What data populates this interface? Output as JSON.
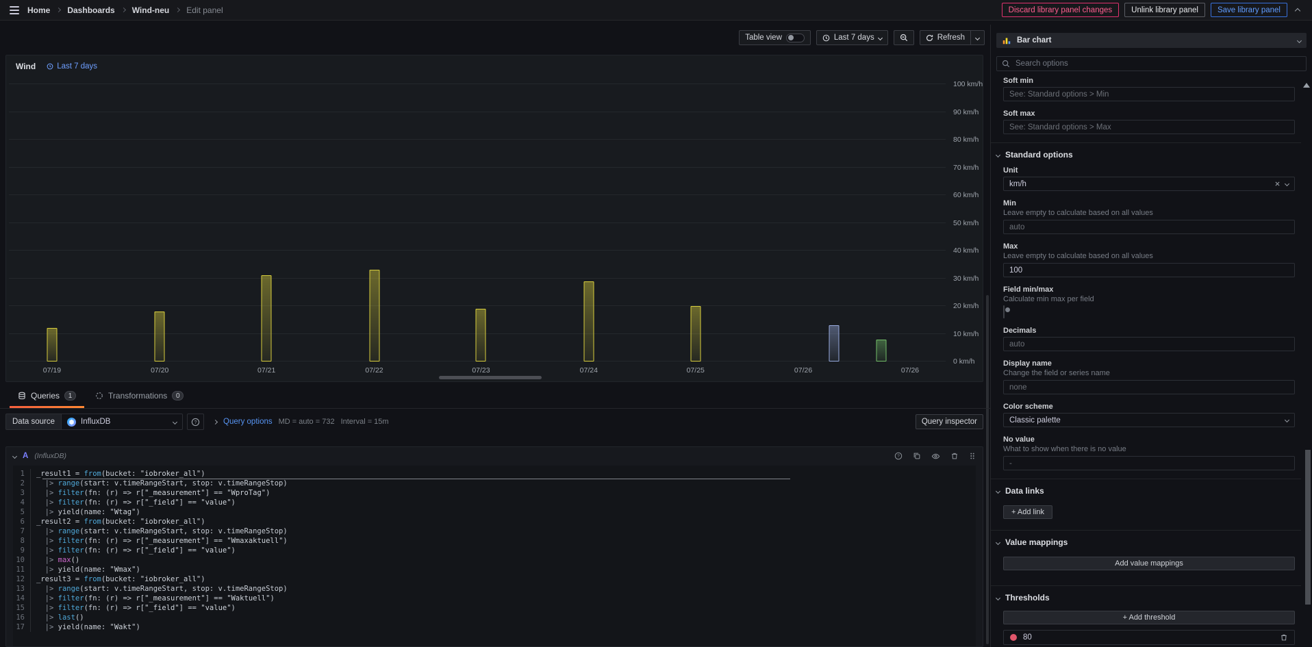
{
  "topnav": {
    "breadcrumb": [
      "Home",
      "Dashboards",
      "Wind-neu",
      "Edit panel"
    ],
    "discard_label": "Discard library panel changes",
    "unlink_label": "Unlink library panel",
    "save_label": "Save library panel"
  },
  "toolbar": {
    "table_view_label": "Table view",
    "time_range_label": "Last 7 days",
    "refresh_label": "Refresh"
  },
  "panel": {
    "title": "Wind",
    "time_tag": "Last 7 days"
  },
  "chart_data": {
    "type": "bar",
    "title": "Wind",
    "unit": "km/h",
    "ylim": [
      0,
      100
    ],
    "tick_step": 10,
    "grid": true,
    "legend": "none",
    "x_ticks": [
      {
        "f": 0.046,
        "label": "07/19"
      },
      {
        "f": 0.161,
        "label": "07/20"
      },
      {
        "f": 0.275,
        "label": "07/21"
      },
      {
        "f": 0.39,
        "label": "07/22"
      },
      {
        "f": 0.504,
        "label": "07/23"
      },
      {
        "f": 0.619,
        "label": "07/24"
      },
      {
        "f": 0.733,
        "label": "07/25"
      },
      {
        "f": 0.848,
        "label": "07/26"
      },
      {
        "f": 0.962,
        "label": "07/26"
      }
    ],
    "series": [
      {
        "name": "Wtag",
        "color": "#d8ce3d",
        "points": [
          {
            "f": 0.046,
            "value": 12
          },
          {
            "f": 0.161,
            "value": 18
          },
          {
            "f": 0.275,
            "value": 31
          },
          {
            "f": 0.39,
            "value": 33
          },
          {
            "f": 0.504,
            "value": 19
          },
          {
            "f": 0.619,
            "value": 29
          },
          {
            "f": 0.733,
            "value": 20
          }
        ]
      },
      {
        "name": "Wmax",
        "color": "#98abdf",
        "points": [
          {
            "f": 0.881,
            "value": 13
          }
        ]
      },
      {
        "name": "Wakt",
        "color": "#73bf69",
        "points": [
          {
            "f": 0.931,
            "value": 8
          }
        ]
      }
    ]
  },
  "queries_pane": {
    "tabs": {
      "queries_label": "Queries",
      "queries_badge": "1",
      "transformations_label": "Transformations",
      "transformations_badge": "0"
    },
    "datasource_label": "Data source",
    "datasource_value": "InfluxDB",
    "query_options_label": "Query options",
    "query_options_meta": "MD = auto = 732",
    "interval_meta": "Interval = 15m",
    "inspector_label": "Query inspector",
    "query": {
      "ref": "A",
      "ds_hint": "(InfluxDB)",
      "code_lines": [
        "_result1 = from(bucket: \"iobroker_all\")",
        "  |> range(start: v.timeRangeStart, stop: v.timeRangeStop)",
        "  |> filter(fn: (r) => r[\"_measurement\"] == \"WproTag\")",
        "  |> filter(fn: (r) => r[\"_field\"] == \"value\")",
        "  |> yield(name: \"Wtag\")",
        "_result2 = from(bucket: \"iobroker_all\")",
        "  |> range(start: v.timeRangeStart, stop: v.timeRangeStop)",
        "  |> filter(fn: (r) => r[\"_measurement\"] == \"Wmaxaktuell\")",
        "  |> filter(fn: (r) => r[\"_field\"] == \"value\")",
        "  |> max()",
        "  |> yield(name: \"Wmax\")",
        "_result3 = from(bucket: \"iobroker_all\")",
        "  |> range(start: v.timeRangeStart, stop: v.timeRangeStop)",
        "  |> filter(fn: (r) => r[\"_measurement\"] == \"Waktuell\")",
        "  |> filter(fn: (r) => r[\"_field\"] == \"value\")",
        "  |> last()",
        "  |> yield(name: \"Wakt\")"
      ]
    }
  },
  "sidebar": {
    "viz_name": "Bar chart",
    "search_placeholder": "Search options",
    "soft_min": {
      "label": "Soft min",
      "placeholder": "See: Standard options > Min"
    },
    "soft_max": {
      "label": "Soft max",
      "placeholder": "See: Standard options > Max"
    },
    "standard": {
      "header": "Standard options",
      "unit": {
        "label": "Unit",
        "value": "km/h"
      },
      "min": {
        "label": "Min",
        "desc": "Leave empty to calculate based on all values",
        "placeholder": "auto"
      },
      "max": {
        "label": "Max",
        "desc": "Leave empty to calculate based on all values",
        "value": "100"
      },
      "field_minmax": {
        "label": "Field min/max",
        "desc": "Calculate min max per field"
      },
      "decimals": {
        "label": "Decimals",
        "placeholder": "auto"
      },
      "display_name": {
        "label": "Display name",
        "desc": "Change the field or series name",
        "placeholder": "none"
      },
      "color_scheme": {
        "label": "Color scheme",
        "value": "Classic palette"
      },
      "no_value": {
        "label": "No value",
        "desc": "What to show when there is no value",
        "placeholder": "-"
      }
    },
    "data_links": {
      "header": "Data links",
      "add_label": "+ Add link"
    },
    "value_mappings": {
      "header": "Value mappings",
      "add_label": "Add value mappings"
    },
    "thresholds": {
      "header": "Thresholds",
      "add_label": "+ Add threshold",
      "items": [
        {
          "value": "80",
          "color": "#e0566b"
        }
      ]
    }
  },
  "colors": {
    "accent_orange": "#ff780a",
    "link_blue": "#5794f2",
    "threshold_red": "#e0566b"
  }
}
